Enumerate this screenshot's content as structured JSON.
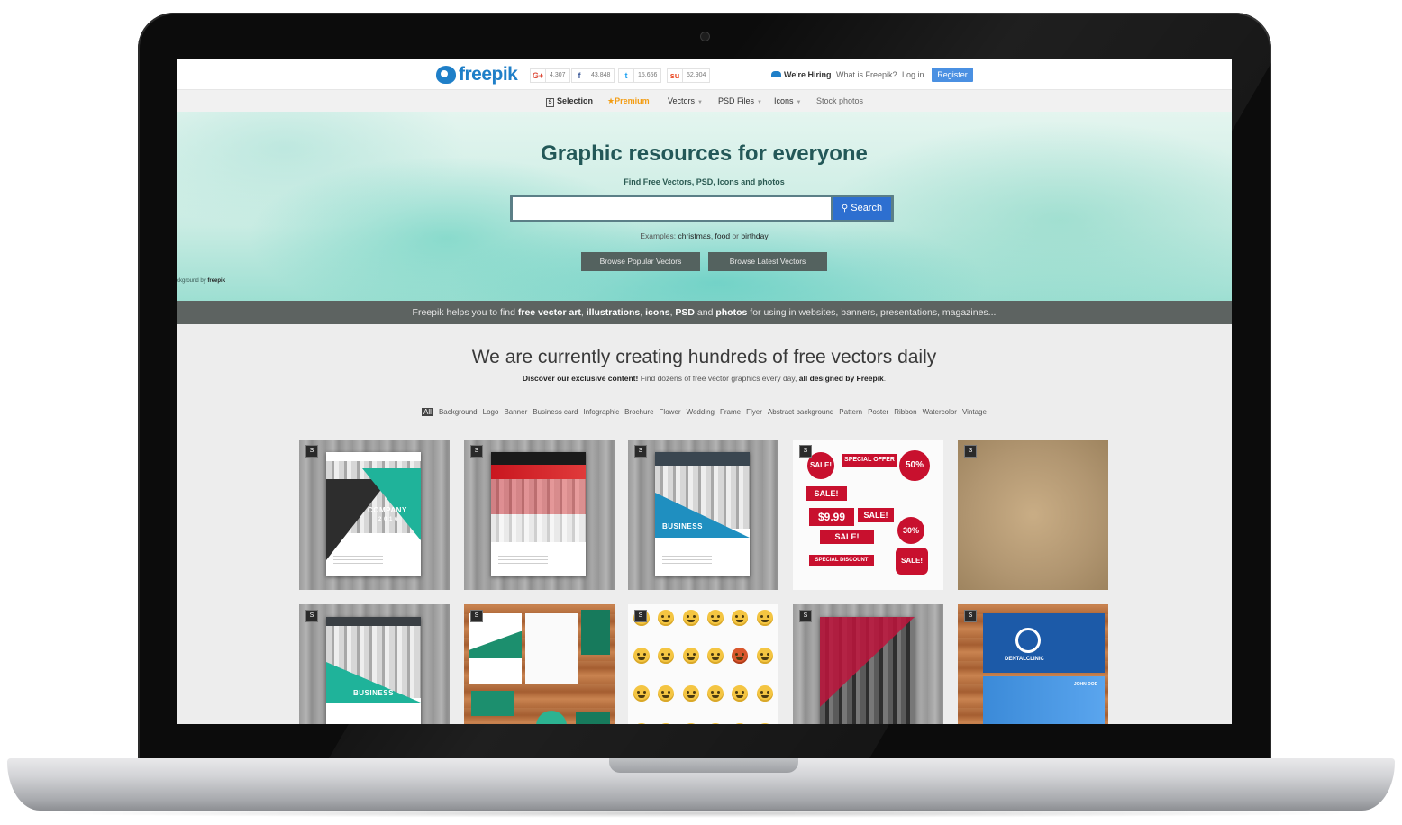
{
  "header": {
    "logo_text": "freepik",
    "social": [
      {
        "icon": "google-plus-icon",
        "glyph": "G+",
        "count": "4,307",
        "color": "#dd4b39"
      },
      {
        "icon": "facebook-icon",
        "glyph": "f",
        "count": "43,848",
        "color": "#3b5998"
      },
      {
        "icon": "twitter-icon",
        "glyph": "t",
        "count": "15,656",
        "color": "#1da1f2"
      },
      {
        "icon": "stumbleupon-icon",
        "glyph": "su",
        "count": "52,904",
        "color": "#eb4924"
      }
    ],
    "hiring": "We're Hiring",
    "what_is": "What is Freepik?",
    "login": "Log in",
    "register": "Register"
  },
  "nav": {
    "selection": "Selection",
    "premium": "Premium",
    "vectors": "Vectors",
    "psd_files": "PSD Files",
    "icons": "Icons",
    "stock_photos": "Stock photos"
  },
  "hero": {
    "title": "Graphic resources for everyone",
    "subtitle": "Find Free Vectors, PSD, Icons and photos",
    "search_value": "",
    "search_button": "Search",
    "examples_prefix": "Examples:",
    "example_1": "christmas",
    "example_2": "food",
    "example_3": "birthday",
    "browse_popular": "Browse Popular Vectors",
    "browse_latest": "Browse Latest Vectors",
    "bg_credit_prefix": "ckground by",
    "bg_credit_brand": "freepik"
  },
  "banner": {
    "part1": "Freepik helps you to find",
    "b1": "free vector art",
    "b2": "illustrations",
    "b3": "icons",
    "b4": "PSD",
    "b5": "photos",
    "part_end": "for using in websites, banners, presentations, magazines..."
  },
  "main": {
    "title": "We are currently creating hundreds of free vectors daily",
    "sub_bold": "Discover our exclusive content!",
    "sub_text": "Find dozens of free vector graphics every day,",
    "sub_bold2": "all designed by Freepik",
    "filters": [
      "All",
      "Background",
      "Logo",
      "Banner",
      "Business card",
      "Infographic",
      "Brochure",
      "Flower",
      "Wedding",
      "Frame",
      "Flyer",
      "Abstract background",
      "Pattern",
      "Poster",
      "Ribbon",
      "Watercolor",
      "Vintage"
    ]
  },
  "grid": {
    "badge": "S",
    "brochure1_text": "COMPANY",
    "brochure1_year": "2 0 1 6",
    "brochure3_text": "BUSINESS",
    "sale_1": "SALE!",
    "sale_offer": "SPECIAL OFFER",
    "sale_50": "50%",
    "sale_price": "$9.99",
    "sale_30": "30%",
    "sale_discount": "SPECIAL DISCOUNT",
    "brochure6_text": "BUSINESS",
    "dental": "DENTALCLINIC",
    "dental_name": "JOHN DOE"
  },
  "colors": {
    "brand_blue": "#1f7fc8",
    "search_button": "#2d6fd0",
    "register": "#4a90e2",
    "premium": "#f39c12",
    "sale_red": "#c8102e",
    "teal": "#1fb39a"
  }
}
